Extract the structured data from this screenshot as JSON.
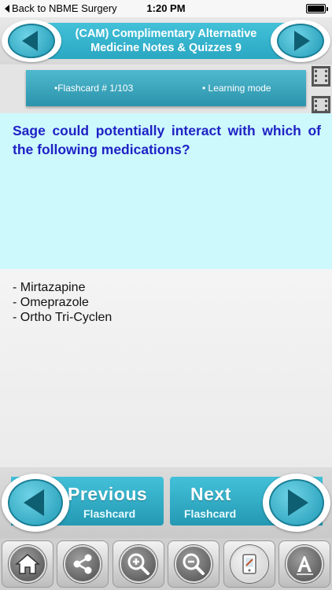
{
  "status_bar": {
    "back_label": "Back to NBME Surgery",
    "time": "1:20 PM"
  },
  "header": {
    "title_line1": "(CAM) Complimentary Alternative",
    "title_line2": "Medicine Notes & Quizzes 9"
  },
  "info": {
    "flashcard_label": "•Flashcard #  1/103",
    "mode_label": "• Learning mode"
  },
  "question": {
    "text": "Sage could potentially interact with which of the following medications?"
  },
  "answer": {
    "lines": [
      "- Mirtazapine",
      "- Omeprazole",
      "- Ortho Tri-Cyclen"
    ]
  },
  "bottom_nav": {
    "previous_title": "Previous",
    "previous_sub": "Flashcard",
    "next_title": "Next",
    "next_sub": "Flashcard"
  },
  "toolbar": {
    "icons": [
      "home-icon",
      "share-icon",
      "zoom-in-icon",
      "zoom-out-icon",
      "notes-icon",
      "font-icon"
    ]
  },
  "colors": {
    "accent": "#2ba8c3",
    "question_bg": "#cdf9fc",
    "question_text": "#1f22c5"
  }
}
